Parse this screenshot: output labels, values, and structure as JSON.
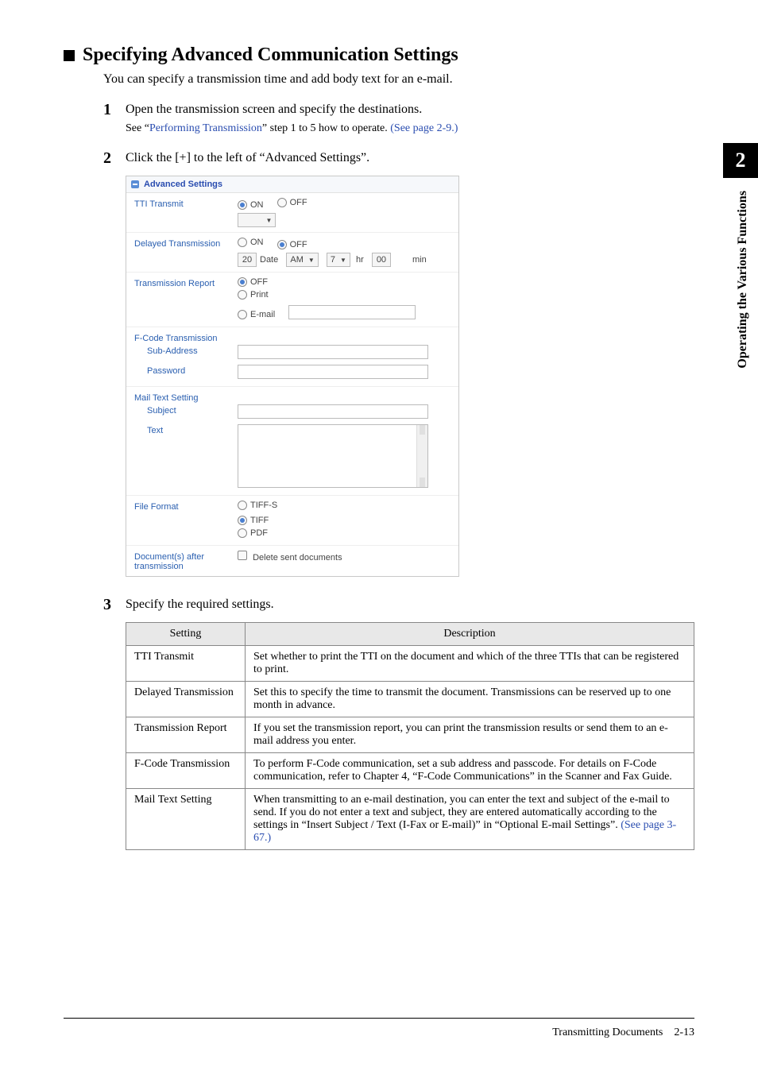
{
  "side": {
    "chapter_number": "2",
    "side_label": "Operating the Various Functions"
  },
  "heading": "Specifying Advanced Communication Settings",
  "intro": "You can specify a transmission time and add body text for an e-mail.",
  "steps": {
    "s1": {
      "num": "1",
      "body": "Open the transmission screen and specify the destinations.",
      "note_pre": "See “",
      "note_link1": "Performing Transmission",
      "note_mid": "” step 1 to 5 how to operate. ",
      "note_link2": "(See page 2-9.)"
    },
    "s2": {
      "num": "2",
      "body": "Click the [+] to the left of “Advanced Settings”."
    },
    "s3": {
      "num": "3",
      "body": "Specify the required settings."
    }
  },
  "panel": {
    "title": "Advanced Settings",
    "rows": {
      "tti": {
        "label": "TTI Transmit",
        "on": "ON",
        "off": "OFF"
      },
      "delayed": {
        "label": "Delayed Transmission",
        "on": "ON",
        "off": "OFF",
        "date_val": "20",
        "date_lbl": "Date",
        "ampm": "AM",
        "hr_val": "7",
        "hr_lbl": "hr",
        "min_val": "00",
        "min_lbl": "min"
      },
      "report": {
        "label": "Transmission Report",
        "off": "OFF",
        "print": "Print",
        "email": "E-mail"
      },
      "fcode": {
        "label": "F-Code Transmission",
        "sub": "Sub-Address",
        "pass": "Password"
      },
      "mail": {
        "label": "Mail Text Setting",
        "subject": "Subject",
        "text": "Text"
      },
      "file": {
        "label": "File Format",
        "tiffs": "TIFF-S",
        "tiff": "TIFF",
        "pdf": "PDF"
      },
      "docs": {
        "label": "Document(s) after transmission",
        "chk": "Delete sent documents"
      }
    }
  },
  "table": {
    "h1": "Setting",
    "h2": "Description",
    "rows": [
      {
        "setting": "TTI Transmit",
        "desc": "Set whether to print the TTI on the document and which of the three TTIs that can be registered to print."
      },
      {
        "setting": "Delayed Transmission",
        "desc": "Set this to specify the time to transmit the document. Transmissions can be reserved up to one month in advance."
      },
      {
        "setting": "Transmission Report",
        "desc": "If you set the transmission report, you can print the transmission results or send them to an e-mail address you enter."
      },
      {
        "setting": "F-Code Transmission",
        "desc": "To perform F-Code communication, set a sub address and passcode. For details on F-Code communication, refer to Chapter 4, “F-Code Communications” in the Scanner and Fax Guide."
      },
      {
        "setting": "Mail Text Setting",
        "desc_pre": "When transmitting to an e-mail destination, you can enter the text and subject of the e-mail to send. If you do not enter a text and subject, they are entered automatically according to the settings in “Insert Subject / Text (I-Fax or E-mail)” in “Optional E-mail Settings”. ",
        "desc_link": "(See page 3-67.)"
      }
    ]
  },
  "footer": {
    "title": "Transmitting Documents",
    "page": "2-13"
  }
}
